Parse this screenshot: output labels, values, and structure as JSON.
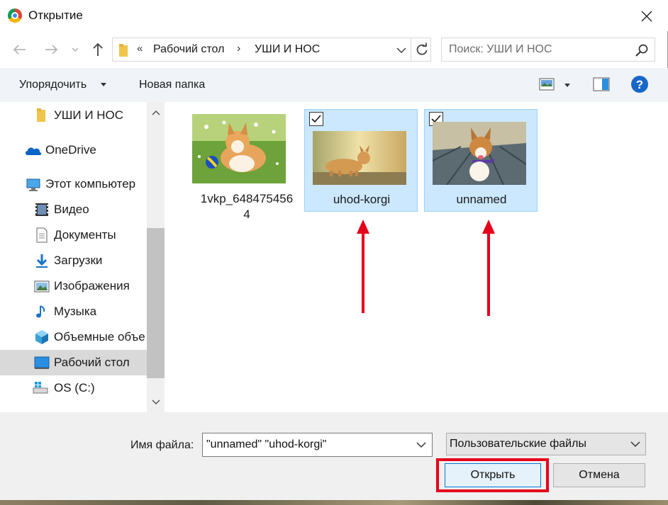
{
  "window": {
    "title": "Открытие"
  },
  "address_bar": {
    "chevron": "«",
    "crumbs": [
      "Рабочий стол",
      "УШИ И НОС"
    ],
    "separator": "›"
  },
  "search": {
    "placeholder": "Поиск: УШИ И НОС"
  },
  "toolbar": {
    "organize_label": "Упорядочить",
    "new_folder_label": "Новая папка",
    "help_glyph": "?"
  },
  "nav_tree": {
    "items": [
      {
        "label": "УШИ И НОС",
        "icon": "folder-icon"
      },
      {
        "label": "OneDrive",
        "icon": "cloud-icon"
      },
      {
        "label": "Этот компьютер",
        "icon": "computer-icon"
      },
      {
        "label": "Видео",
        "icon": "video-icon"
      },
      {
        "label": "Документы",
        "icon": "document-icon"
      },
      {
        "label": "Загрузки",
        "icon": "download-icon"
      },
      {
        "label": "Изображения",
        "icon": "pictures-icon"
      },
      {
        "label": "Музыка",
        "icon": "music-icon"
      },
      {
        "label": "Объемные объе",
        "icon": "3d-objects-icon"
      },
      {
        "label": "Рабочий стол",
        "icon": "desktop-icon",
        "selected": true
      },
      {
        "label": "OS (C:)",
        "icon": "drive-icon"
      }
    ]
  },
  "files": [
    {
      "name_line1": "1vkp_648475456",
      "name_line2": "4",
      "selected": false
    },
    {
      "name_line1": "uhod-korgi",
      "name_line2": "",
      "selected": true
    },
    {
      "name_line1": "unnamed",
      "name_line2": "",
      "selected": true
    }
  ],
  "bottom": {
    "filename_label": "Имя файла:",
    "filename_value": "\"unnamed\" \"uhod-korgi\"",
    "filter_value": "Пользовательские файлы",
    "open_label": "Открыть",
    "cancel_label": "Отмена"
  },
  "colors": {
    "accent": "#0078d7",
    "selection_bg": "#cce8ff",
    "annotation_red": "#e5001b"
  }
}
